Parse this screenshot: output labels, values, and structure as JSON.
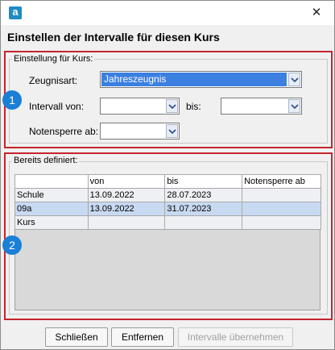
{
  "window": {
    "app_icon_letter": "a",
    "close_glyph": "✕"
  },
  "dialog": {
    "heading": "Einstellen der Intervalle für diesen Kurs"
  },
  "settings_group": {
    "legend": "Einstellung für Kurs:",
    "zeugnisart_label": "Zeugnisart:",
    "zeugnisart_value": "Jahreszeugnis",
    "intervall_von_label": "Intervall von:",
    "intervall_von_value": "",
    "bis_label": "bis:",
    "bis_value": "",
    "notensperre_label": "Notensperre ab:",
    "notensperre_value": ""
  },
  "defined_group": {
    "legend": "Bereits definiert:",
    "columns": [
      "",
      "von",
      "bis",
      "Notensperre ab"
    ],
    "rows": [
      [
        "Schule",
        "13.09.2022",
        "28.07.2023",
        ""
      ],
      [
        "09a",
        "13.09.2022",
        "31.07.2023",
        ""
      ],
      [
        "Kurs",
        "",
        "",
        ""
      ]
    ]
  },
  "badges": {
    "one": "1",
    "two": "2"
  },
  "buttons": {
    "close": "Schließen",
    "remove": "Entfernen",
    "apply": "Intervalle übernehmen"
  },
  "colors": {
    "highlight_border": "#c4252c",
    "badge": "#1a7fd6",
    "selection": "#3b7fe0"
  }
}
